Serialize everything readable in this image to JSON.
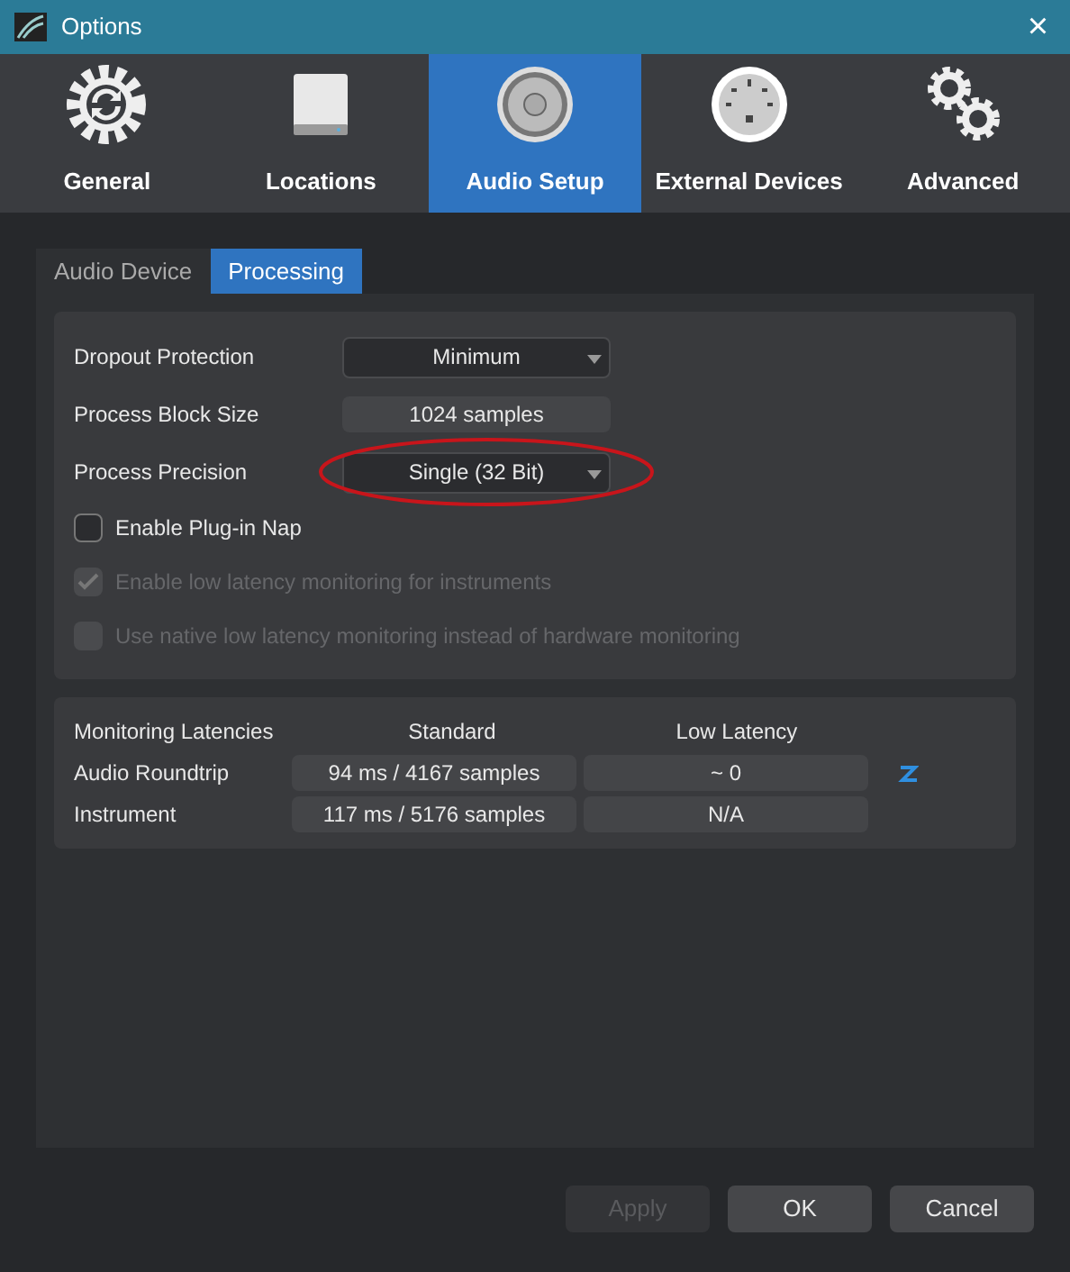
{
  "window": {
    "title": "Options",
    "close": "×"
  },
  "categories": [
    {
      "label": "General",
      "kind": "gear",
      "selected": false
    },
    {
      "label": "Locations",
      "kind": "drive",
      "selected": false
    },
    {
      "label": "Audio Setup",
      "kind": "speaker",
      "selected": true
    },
    {
      "label": "External Devices",
      "kind": "midi",
      "selected": false
    },
    {
      "label": "Advanced",
      "kind": "gears",
      "selected": false
    }
  ],
  "tabs": [
    {
      "label": "Audio Device",
      "selected": false
    },
    {
      "label": "Processing",
      "selected": true
    }
  ],
  "settings": [
    {
      "kind": "dropdown",
      "label": "Dropout Protection",
      "value": "Minimum",
      "highlighted": false
    },
    {
      "kind": "readout",
      "label": "Process Block Size",
      "value": "1024 samples",
      "highlighted": false
    },
    {
      "kind": "dropdown",
      "label": "Process Precision",
      "value": "Single (32 Bit)",
      "highlighted": true
    }
  ],
  "checkboxes": [
    {
      "label": "Enable Plug-in Nap",
      "checked": false,
      "disabled": false
    },
    {
      "label": "Enable low latency monitoring for instruments",
      "checked": true,
      "disabled": true
    },
    {
      "label": "Use native low latency monitoring instead of hardware monitoring",
      "checked": false,
      "disabled": true
    }
  ],
  "latencies": {
    "columns": [
      "Monitoring Latencies",
      "Standard",
      "Low Latency"
    ],
    "rows": [
      {
        "label": "Audio Roundtrip",
        "standard": "94 ms / 4167 samples",
        "low": "~ 0",
        "zero_latency": true
      },
      {
        "label": "Instrument",
        "standard": "117 ms / 5176 samples",
        "low": "N/A",
        "zero_latency": false
      }
    ]
  },
  "buttons": [
    {
      "label": "Apply",
      "disabled": true
    },
    {
      "label": "OK",
      "disabled": false
    },
    {
      "label": "Cancel",
      "disabled": false
    }
  ]
}
